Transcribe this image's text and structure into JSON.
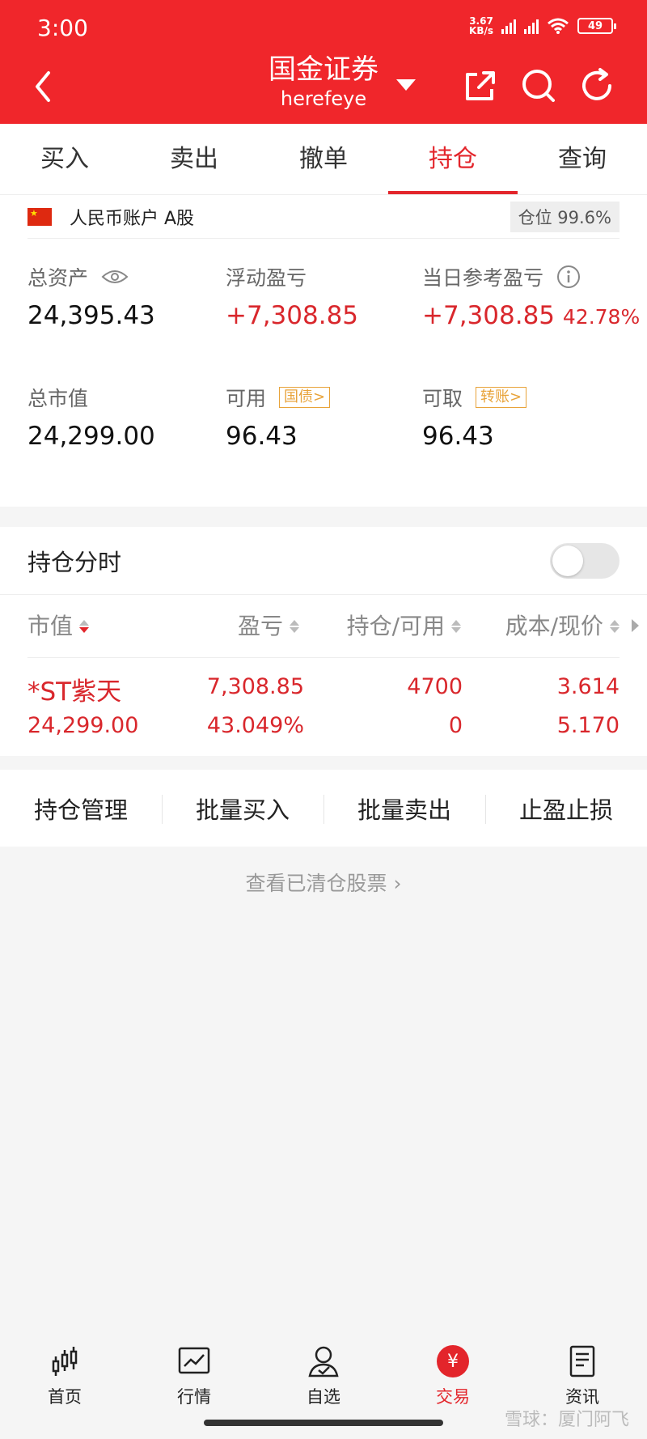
{
  "status_bar": {
    "time": "3:00",
    "net_speed": "3.67",
    "net_unit": "KB/s",
    "battery": "49"
  },
  "header": {
    "title": "国金证券",
    "subtitle": "herefeye"
  },
  "tabs": [
    {
      "label": "买入"
    },
    {
      "label": "卖出"
    },
    {
      "label": "撤单"
    },
    {
      "label": "持仓",
      "active": true
    },
    {
      "label": "查询"
    }
  ],
  "account": {
    "name": "人民币账户 A股",
    "position_ratio": "仓位 99.6%"
  },
  "metrics": {
    "total_assets": {
      "label": "总资产",
      "value": "24,395.43"
    },
    "floating_pl": {
      "label": "浮动盈亏",
      "value": "+7,308.85"
    },
    "daily_pl": {
      "label": "当日参考盈亏",
      "value": "+7,308.85",
      "pct": "42.78%"
    },
    "market_value": {
      "label": "总市值",
      "value": "24,299.00"
    },
    "available": {
      "label": "可用",
      "tag": "国债>",
      "value": "96.43"
    },
    "withdrawable": {
      "label": "可取",
      "tag": "转账>",
      "value": "96.43"
    }
  },
  "holdings": {
    "title": "持仓分时",
    "columns": [
      "市值",
      "盈亏",
      "持仓/可用",
      "成本/现价"
    ],
    "rows": [
      {
        "name": "*ST紫天",
        "market_value": "24,299.00",
        "pl": "7,308.85",
        "pl_pct": "43.049%",
        "position": "4700",
        "available": "0",
        "cost": "3.614",
        "price": "5.170"
      }
    ]
  },
  "actions": [
    "持仓管理",
    "批量买入",
    "批量卖出",
    "止盈止损"
  ],
  "cleared_link": "查看已清仓股票 ›",
  "bottom_nav": [
    {
      "label": "首页",
      "icon": "candlestick-icon"
    },
    {
      "label": "行情",
      "icon": "chart-icon"
    },
    {
      "label": "自选",
      "icon": "user-check-icon"
    },
    {
      "label": "交易",
      "icon": "yen-icon",
      "active": true
    },
    {
      "label": "资讯",
      "icon": "document-icon"
    }
  ],
  "watermark": "雪球：厦门阿飞",
  "colors": {
    "brand": "#f0262b",
    "up": "#d9272c",
    "tag": "#e8a33a"
  }
}
